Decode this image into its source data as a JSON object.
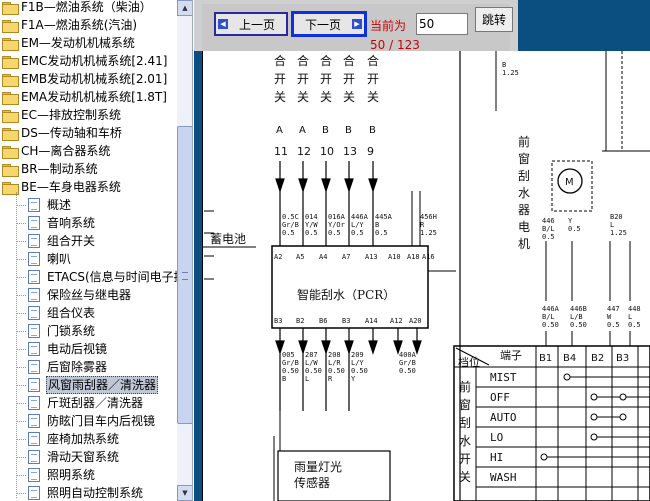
{
  "tree": {
    "items": [
      {
        "label": "F1B—燃油系统（柴油）",
        "type": "folder"
      },
      {
        "label": "F1A—燃油系统(汽油)",
        "type": "folder"
      },
      {
        "label": "EM—发动机机械系统",
        "type": "folder"
      },
      {
        "label": "EMC发动机机械系统[2.41]",
        "type": "folder"
      },
      {
        "label": "EMB发动机机械系统[2.01]",
        "type": "folder"
      },
      {
        "label": "EMA发动机机械系统[1.8T]",
        "type": "folder"
      },
      {
        "label": "EC—排放控制系统",
        "type": "folder"
      },
      {
        "label": "DS—传动轴和车桥",
        "type": "folder"
      },
      {
        "label": "CH—离合器系统",
        "type": "folder"
      },
      {
        "label": "BR—制动系统",
        "type": "folder"
      },
      {
        "label": "BE—车身电器系统",
        "type": "folder-open"
      },
      {
        "label": "概述",
        "type": "doc"
      },
      {
        "label": "音响系统",
        "type": "doc"
      },
      {
        "label": "组合开关",
        "type": "doc"
      },
      {
        "label": "喇叭",
        "type": "doc"
      },
      {
        "label": "ETACS(信息与时间电子控制系统)",
        "type": "doc"
      },
      {
        "label": "保险丝与继电器",
        "type": "doc"
      },
      {
        "label": "组合仪表",
        "type": "doc"
      },
      {
        "label": "门锁系统",
        "type": "doc"
      },
      {
        "label": "电动后视镜",
        "type": "doc"
      },
      {
        "label": "后窗除雾器",
        "type": "doc"
      },
      {
        "label": "风窗雨刮器／清洗器",
        "type": "doc",
        "selected": true
      },
      {
        "label": "斤斑刮器／清洗器",
        "type": "doc"
      },
      {
        "label": "防眩门目车内后视镜",
        "type": "doc"
      },
      {
        "label": "座椅加热系统",
        "type": "doc"
      },
      {
        "label": "滑动天窗系统",
        "type": "doc"
      },
      {
        "label": "照明系统",
        "type": "doc"
      },
      {
        "label": "照明自动控制系统",
        "type": "doc"
      }
    ]
  },
  "toolbar": {
    "prev_label": "上一页",
    "next_label": "下一页",
    "current_label": "当前为",
    "page_value": "50",
    "go_label": "跳转",
    "page_count": "50 / 123"
  },
  "diagram": {
    "top_switches": [
      "合开关A11",
      "合开关A12",
      "合开关B10",
      "合开关B13",
      "合开关B9"
    ],
    "switch_digits": [
      "11",
      "12",
      "10",
      "13",
      "9"
    ],
    "battery_label": "蓄电池",
    "pcr_label": "智能刮水（PCR）",
    "motor_label": "前窗刮水器电机",
    "sensor_label": "雨量灯光传感器",
    "switch_side_label": "前窗刮水开关",
    "table_header": [
      "端子",
      "B1",
      "B4",
      "B2",
      "B3"
    ],
    "table_corner": "档位",
    "table_rows": [
      "MIST",
      "OFF",
      "AUTO",
      "LO",
      "HI",
      "WASH"
    ],
    "pcr_top_pins": [
      "A2",
      "A5",
      "A4",
      "A7",
      "A13",
      "A10",
      "A18",
      "A16"
    ],
    "pcr_bottom_pins": [
      "B3",
      "B2",
      "B6",
      "B3",
      "A14",
      "A12",
      "A20"
    ],
    "wire_labels_top": [
      "0.3",
      "0.3",
      "0.3",
      "0.3",
      "0.3",
      "0.3",
      "0.3"
    ],
    "motor_wires": [
      "0.3",
      "0.3",
      "1.25"
    ]
  },
  "colors": {
    "toolbar_bg": "#cfcfcf",
    "blue_band": "#0a4f80",
    "red_text": "#d00000",
    "selected_bg": "#c0c8d8"
  }
}
